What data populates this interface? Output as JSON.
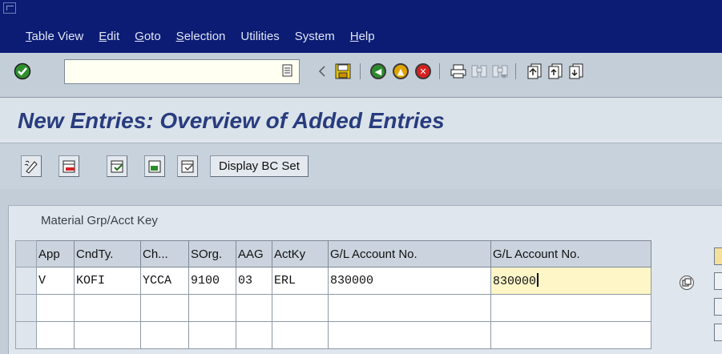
{
  "menu": {
    "items": [
      {
        "underline": "T",
        "rest": "able View"
      },
      {
        "underline": "E",
        "rest": "dit"
      },
      {
        "underline": "G",
        "rest": "oto"
      },
      {
        "underline": "S",
        "rest": "election"
      },
      {
        "underline": "",
        "rest": "Utilities"
      },
      {
        "underline": "",
        "rest": "System"
      },
      {
        "underline": "H",
        "rest": "elp"
      }
    ]
  },
  "toolbar": {
    "command_field_value": "",
    "icons": [
      "enter-icon",
      "dropdown-icon",
      "back-arrow-icon",
      "save-icon",
      "back-icon",
      "exit-icon",
      "cancel-icon",
      "print-icon",
      "find-icon",
      "find-next-icon",
      "first-page-icon",
      "previous-page-icon",
      "next-page-icon"
    ]
  },
  "screen": {
    "title": "New Entries: Overview of Added Entries"
  },
  "app_toolbar": {
    "icons": [
      "change-display-icon",
      "delete-row-icon",
      "select-all-icon",
      "select-block-icon",
      "deselect-all-icon"
    ],
    "bc_set_label": "Display BC Set"
  },
  "table": {
    "caption": "Material Grp/Acct Key",
    "columns": [
      "App",
      "CndTy.",
      "Ch...",
      "SOrg.",
      "AAG",
      "ActKy",
      "G/L Account No.",
      "G/L Account No."
    ],
    "rows": [
      [
        "V",
        "KOFI",
        "YCCA",
        "9100",
        "03",
        "ERL",
        "830000",
        "830000"
      ],
      [
        "",
        "",
        "",
        "",
        "",
        "",
        "",
        ""
      ],
      [
        "",
        "",
        "",
        "",
        "",
        "",
        "",
        ""
      ]
    ]
  },
  "colors": {
    "menubar": "#0c1c74",
    "title": "#283c7e",
    "active_cell": "#fff6c8"
  }
}
